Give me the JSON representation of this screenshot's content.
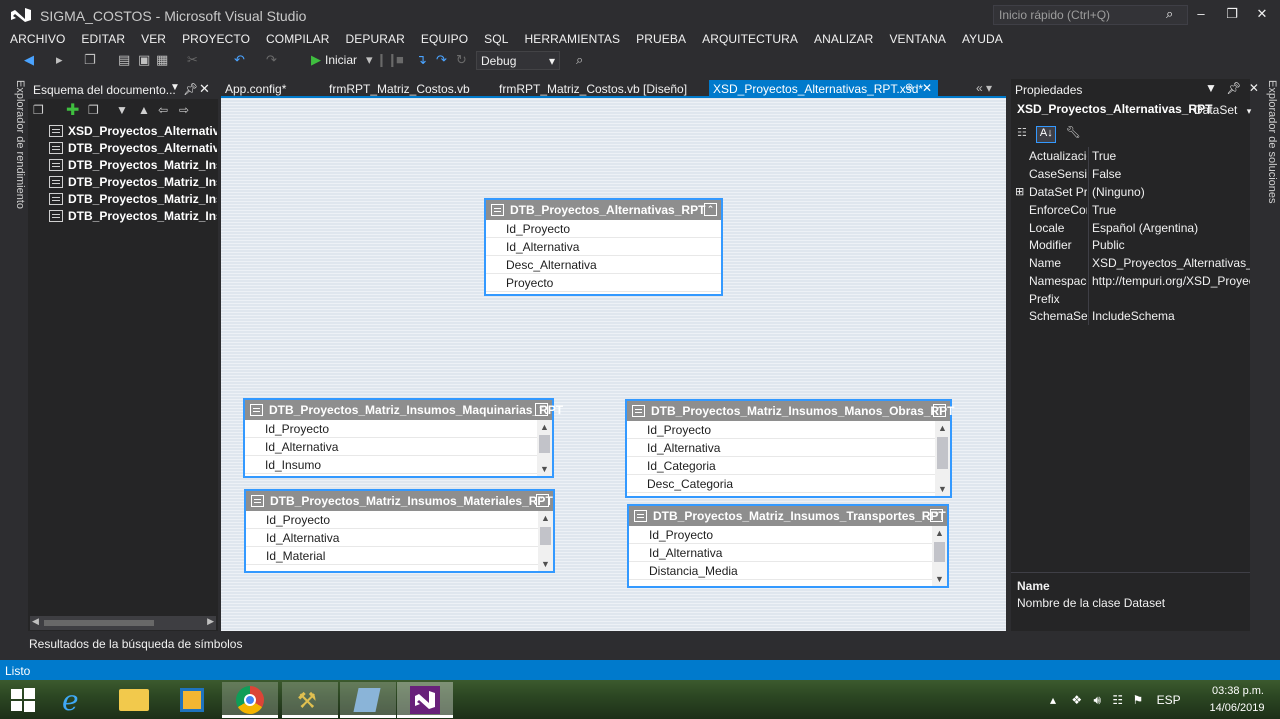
{
  "window": {
    "title": "SIGMA_COSTOS - Microsoft Visual Studio",
    "quick_launch_placeholder": "Inicio rápido (Ctrl+Q)"
  },
  "menu": [
    "ARCHIVO",
    "EDITAR",
    "VER",
    "PROYECTO",
    "COMPILAR",
    "DEPURAR",
    "EQUIPO",
    "SQL",
    "HERRAMIENTAS",
    "PRUEBA",
    "ARQUITECTURA",
    "ANALIZAR",
    "VENTANA",
    "AYUDA"
  ],
  "toolbar": {
    "start_label": "Iniciar",
    "config_value": "Debug"
  },
  "side_tabs": {
    "left": "Explorador de rendimiento",
    "right": "Explorador de soluciones"
  },
  "outline": {
    "title": "Esquema del documento...",
    "items": [
      "XSD_Proyectos_Alternativas",
      "DTB_Proyectos_Alternativas",
      "DTB_Proyectos_Matriz_Insum",
      "DTB_Proyectos_Matriz_Insum",
      "DTB_Proyectos_Matriz_Insum",
      "DTB_Proyectos_Matriz_Insum"
    ]
  },
  "symbol_results": "Resultados de la búsqueda de símbolos",
  "tabs": [
    {
      "label": "App.config*"
    },
    {
      "label": "frmRPT_Matriz_Costos.vb"
    },
    {
      "label": "frmRPT_Matriz_Costos.vb [Diseño]"
    },
    {
      "label": "XSD_Proyectos_Alternativas_RPT.xsd*"
    }
  ],
  "tables": {
    "alternativas": {
      "title": "DTB_Proyectos_Alternativas_RPT",
      "columns": [
        "Id_Proyecto",
        "Id_Alternativa",
        "Desc_Alternativa",
        "Proyecto"
      ]
    },
    "maquinarias": {
      "title": "DTB_Proyectos_Matriz_Insumos_Maquinarias_RPT",
      "columns": [
        "Id_Proyecto",
        "Id_Alternativa",
        "Id_Insumo"
      ]
    },
    "materiales": {
      "title": "DTB_Proyectos_Matriz_Insumos_Materiales_RPT",
      "columns": [
        "Id_Proyecto",
        "Id_Alternativa",
        "Id_Material"
      ]
    },
    "manos_obras": {
      "title": "DTB_Proyectos_Matriz_Insumos_Manos_Obras_RPT",
      "columns": [
        "Id_Proyecto",
        "Id_Alternativa",
        "Id_Categoria",
        "Desc_Categoria"
      ]
    },
    "transportes": {
      "title": "DTB_Proyectos_Matriz_Insumos_Transportes_RPT",
      "columns": [
        "Id_Proyecto",
        "Id_Alternativa",
        "Distancia_Media"
      ]
    }
  },
  "properties": {
    "title": "Propiedades",
    "object_name": "XSD_Proyectos_Alternativas_RPT",
    "object_type": "DataSet",
    "rows": [
      {
        "name": "Actualizació",
        "value": "True",
        "expander": ""
      },
      {
        "name": "CaseSensitiv",
        "value": "False",
        "expander": ""
      },
      {
        "name": "DataSet Pro",
        "value": "(Ninguno)",
        "expander": "⊞"
      },
      {
        "name": "EnforceCon",
        "value": "True",
        "expander": ""
      },
      {
        "name": "Locale",
        "value": "Español (Argentina)",
        "expander": ""
      },
      {
        "name": "Modifier",
        "value": "Public",
        "expander": ""
      },
      {
        "name": "Name",
        "value": "XSD_Proyectos_Alternativas_RPT",
        "expander": ""
      },
      {
        "name": "Namespace",
        "value": "http://tempuri.org/XSD_Proyect",
        "expander": ""
      },
      {
        "name": "Prefix",
        "value": "",
        "expander": ""
      },
      {
        "name": "SchemaSeri",
        "value": "IncludeSchema",
        "expander": ""
      }
    ],
    "desc_name": "Name",
    "desc_text": "Nombre de la clase Dataset"
  },
  "status": "Listo",
  "taskbar": {
    "language": "ESP",
    "time": "03:38 p.m.",
    "date": "14/06/2019"
  },
  "colors": {
    "accent": "#007acc",
    "table_border": "#3399ff",
    "table_header": "#8e8e8e"
  }
}
